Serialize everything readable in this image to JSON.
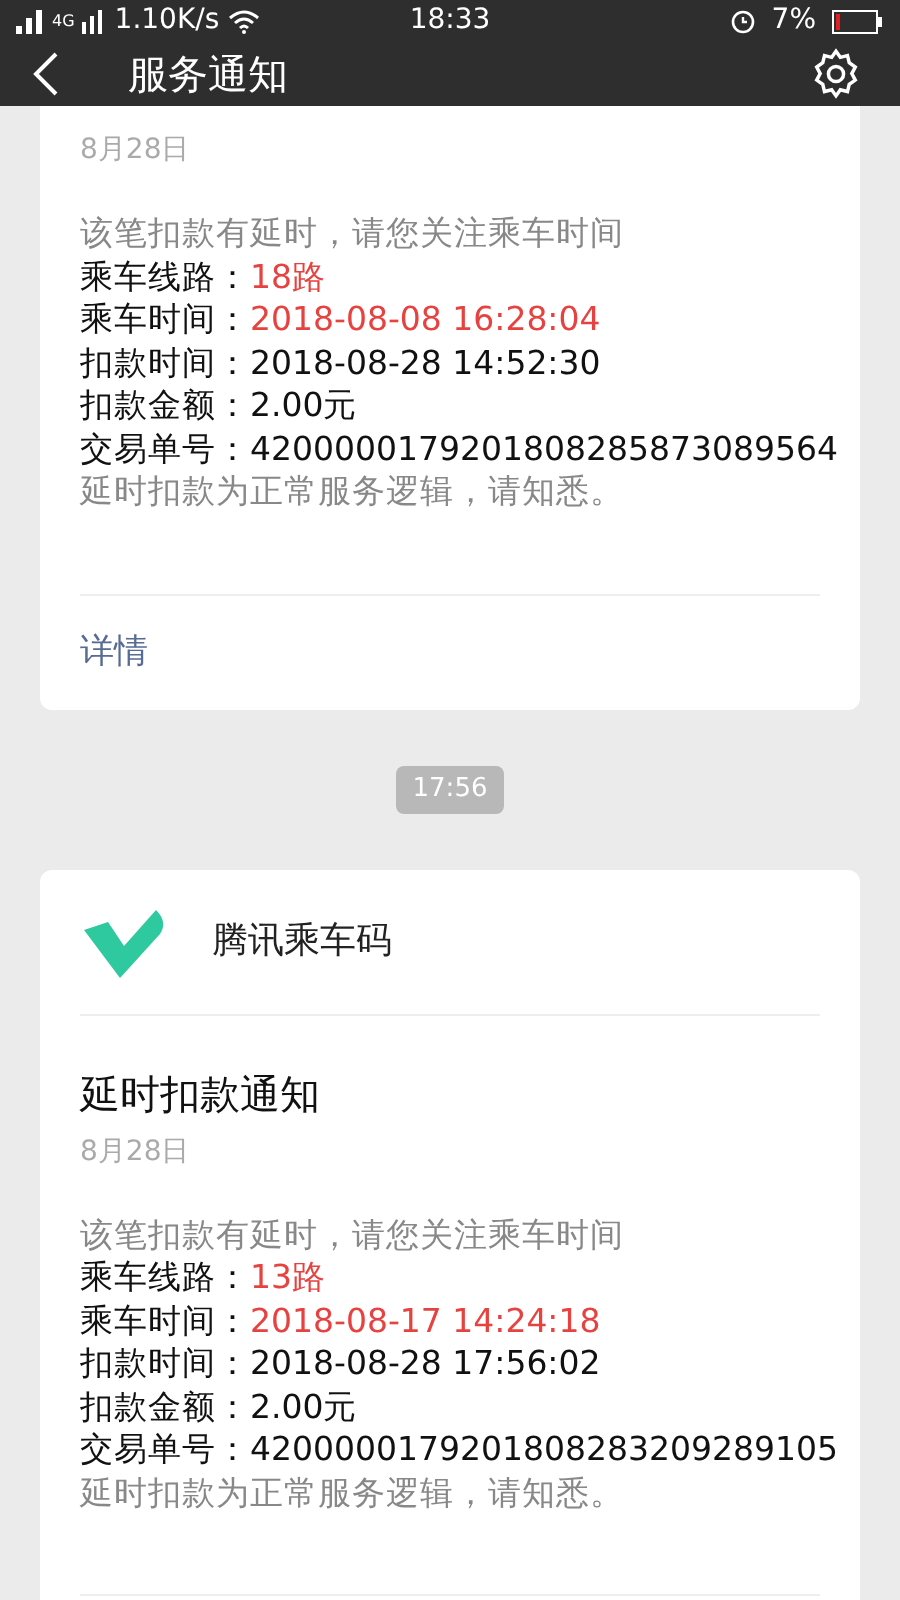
{
  "status_bar": {
    "network": "4G",
    "speed": "1.10K/s",
    "time": "18:33",
    "battery": "7%"
  },
  "header": {
    "title": "服务通知"
  },
  "messages": [
    {
      "kind": "card",
      "date": "8月28日",
      "intro": "该笔扣款有延时，请您关注乘车时间",
      "fields": [
        {
          "label": "乘车线路：",
          "value": "18路",
          "highlight": true
        },
        {
          "label": "乘车时间：",
          "value": "2018-08-08 16:28:04",
          "highlight": true
        },
        {
          "label": "扣款时间：",
          "value": "2018-08-28 14:52:30",
          "highlight": false
        },
        {
          "label": "扣款金额：",
          "value": "2.00元",
          "highlight": false
        },
        {
          "label": "交易单号：",
          "value": "4200000179201808285873089564",
          "highlight": false
        }
      ],
      "note": "延时扣款为正常服务逻辑，请知悉。",
      "link": "详情"
    },
    {
      "kind": "time",
      "text": "17:56"
    },
    {
      "kind": "card",
      "app": "腾讯乘车码",
      "title": "延时扣款通知",
      "date": "8月28日",
      "intro": "该笔扣款有延时，请您关注乘车时间",
      "fields": [
        {
          "label": "乘车线路：",
          "value": "13路",
          "highlight": true
        },
        {
          "label": "乘车时间：",
          "value": "2018-08-17 14:24:18",
          "highlight": true
        },
        {
          "label": "扣款时间：",
          "value": "2018-08-28 17:56:02",
          "highlight": false
        },
        {
          "label": "扣款金额：",
          "value": "2.00元",
          "highlight": false
        },
        {
          "label": "交易单号：",
          "value": "4200000179201808283209289105",
          "highlight": false
        }
      ],
      "note": "延时扣款为正常服务逻辑，请知悉。"
    }
  ]
}
